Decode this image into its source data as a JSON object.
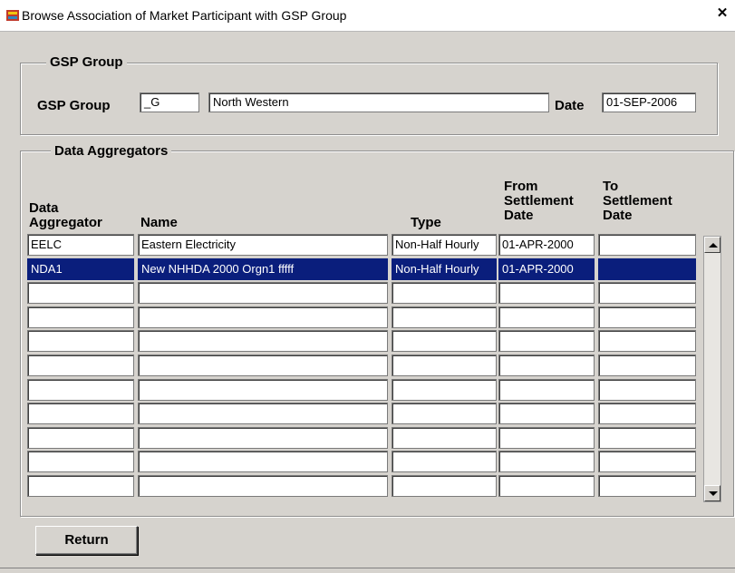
{
  "window": {
    "title": "Browse Association of Market Participant with GSP Group",
    "close_glyph": "✕"
  },
  "gsp_group_frame": {
    "title": "GSP Group",
    "gsp_group_label": "GSP Group",
    "gsp_group_code": "_G",
    "gsp_group_name": "North Western",
    "date_label": "Date",
    "date_value": "01-SEP-2006"
  },
  "data_aggregators_frame": {
    "title": "Data Aggregators",
    "columns": {
      "data_aggregator": "Data\nAggregator",
      "name": "Name",
      "type": "Type",
      "from_date": "From\nSettlement\nDate",
      "to_date": "To\nSettlement\nDate"
    },
    "rows": [
      {
        "aggregator": "EELC",
        "name": "Eastern Electricity",
        "type": "Non-Half Hourly",
        "from": "01-APR-2000",
        "to": ""
      },
      {
        "aggregator": "NDA1",
        "name": "New NHHDA 2000 Orgn1 fffff",
        "type": "Non-Half Hourly",
        "from": "01-APR-2000",
        "to": "",
        "selected": true
      },
      {
        "aggregator": "",
        "name": "",
        "type": "",
        "from": "",
        "to": ""
      },
      {
        "aggregator": "",
        "name": "",
        "type": "",
        "from": "",
        "to": ""
      },
      {
        "aggregator": "",
        "name": "",
        "type": "",
        "from": "",
        "to": ""
      },
      {
        "aggregator": "",
        "name": "",
        "type": "",
        "from": "",
        "to": ""
      },
      {
        "aggregator": "",
        "name": "",
        "type": "",
        "from": "",
        "to": ""
      },
      {
        "aggregator": "",
        "name": "",
        "type": "",
        "from": "",
        "to": ""
      },
      {
        "aggregator": "",
        "name": "",
        "type": "",
        "from": "",
        "to": ""
      },
      {
        "aggregator": "",
        "name": "",
        "type": "",
        "from": "",
        "to": ""
      },
      {
        "aggregator": "",
        "name": "",
        "type": "",
        "from": "",
        "to": ""
      }
    ]
  },
  "buttons": {
    "return_label": "Return"
  }
}
